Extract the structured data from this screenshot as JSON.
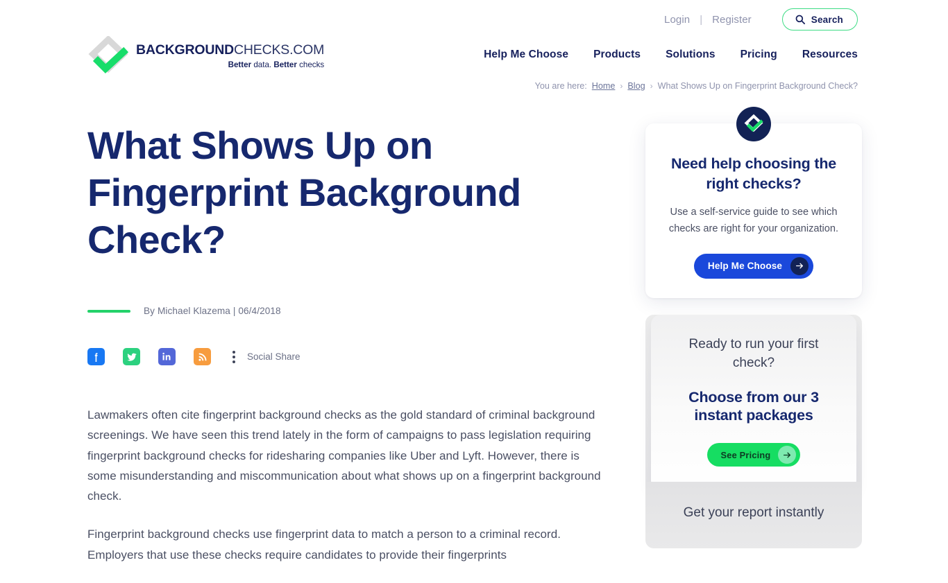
{
  "utility": {
    "login_label": "Login",
    "separator": "|",
    "register_label": "Register",
    "search_label": "Search"
  },
  "brand": {
    "name_bold": "BACKGROUND",
    "name_light": "CHECKS.COM",
    "tagline_bold_1": "Better",
    "tagline_light_1": " data. ",
    "tagline_bold_2": "Better",
    "tagline_light_2": " checks",
    "accent_green": "#24d26a",
    "navy": "#16286e"
  },
  "nav": {
    "items": [
      {
        "label": "Help Me Choose"
      },
      {
        "label": "Products"
      },
      {
        "label": "Solutions"
      },
      {
        "label": "Pricing"
      },
      {
        "label": "Resources"
      }
    ]
  },
  "breadcrumb": {
    "prefix": "You are here:",
    "home": "Home",
    "sep1": "›",
    "blog": "Blog",
    "sep2": "›",
    "current": "What Shows Up on Fingerprint Background Check?"
  },
  "article": {
    "title": "What Shows Up on Fingerprint Background Check?",
    "byline": "By Michael Klazema | 06/4/2018",
    "author": "Michael Klazema",
    "date": "06/4/2018",
    "social_label": "Social Share",
    "social_icons": [
      {
        "name": "facebook-icon",
        "color": "#1878f3"
      },
      {
        "name": "twitter-icon",
        "color": "#2cd17f"
      },
      {
        "name": "linkedin-icon",
        "color": "#5367d8"
      },
      {
        "name": "rss-icon",
        "color": "#f79c3e"
      }
    ],
    "paragraphs": [
      "Lawmakers often cite fingerprint background checks as the gold standard of criminal background screenings. We have seen this trend lately in the form of campaigns to pass legislation requiring fingerprint background checks for ridesharing companies like Uber and Lyft. However, there is some misunderstanding and miscommunication about what shows up on a fingerprint background check.",
      "Fingerprint background checks use fingerprint data to match a person to a criminal record. Employers that use these checks require candidates to provide their fingerprints"
    ]
  },
  "sidebar": {
    "help_card": {
      "heading": "Need help choosing the right checks?",
      "body": "Use a self-service guide to see which checks are right for your organization.",
      "cta_label": "Help Me Choose",
      "cta_color": "#1a48db"
    },
    "pricing_card": {
      "lead": "Ready to run your first check?",
      "heading": "Choose from our 3 instant packages",
      "cta_label": "See Pricing",
      "cta_color": "#16dd62"
    },
    "report_card": {
      "text": "Get your report instantly"
    }
  }
}
